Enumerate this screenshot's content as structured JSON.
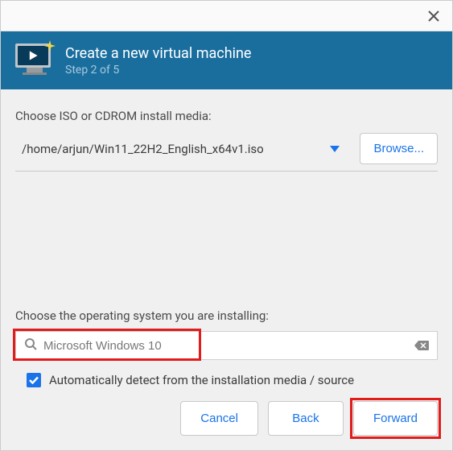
{
  "header": {
    "title": "Create a new virtual machine",
    "step": "Step 2 of 5"
  },
  "media": {
    "label": "Choose ISO or CDROM install media:",
    "path": "/home/arjun/Win11_22H2_English_x64v1.iso",
    "browse_label": "Browse..."
  },
  "os": {
    "label": "Choose the operating system you are installing:",
    "search_value": "Microsoft Windows 10",
    "autodetect_label": "Automatically detect from the installation media / source",
    "autodetect_checked": true
  },
  "buttons": {
    "cancel": "Cancel",
    "back": "Back",
    "forward": "Forward"
  }
}
